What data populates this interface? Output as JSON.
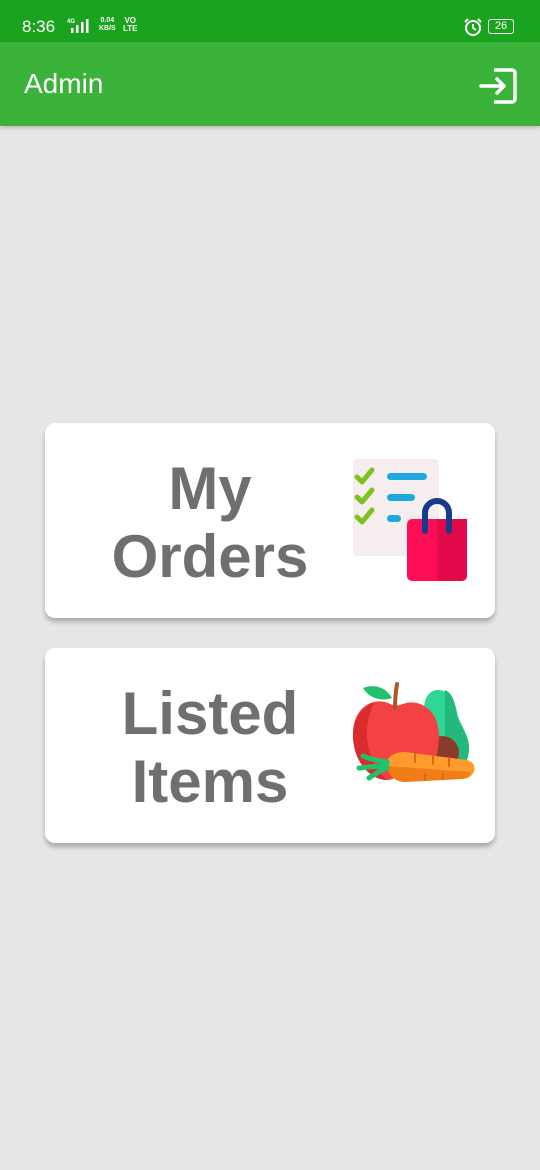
{
  "status_bar": {
    "time": "8:36",
    "network_type": "4G",
    "speed_value": "0.04",
    "speed_unit": "KB/S",
    "volte_top": "VO",
    "volte_bottom": "LTE",
    "battery": "26",
    "icons": [
      "signal-icon",
      "alarm-icon",
      "battery-icon"
    ]
  },
  "app_bar": {
    "title": "Admin",
    "logout_icon": "logout-icon"
  },
  "cards": [
    {
      "line1": "My",
      "line2": "Orders",
      "icon": "orders-checklist-bag-icon"
    },
    {
      "line1": "Listed",
      "line2": "Items",
      "icon": "fruits-vegetables-icon"
    }
  ],
  "colors": {
    "status_bar": "#1aa31f",
    "app_bar": "#3bb33b",
    "background": "#e6e6e6",
    "card": "#ffffff",
    "card_text": "#6f6f6f"
  }
}
